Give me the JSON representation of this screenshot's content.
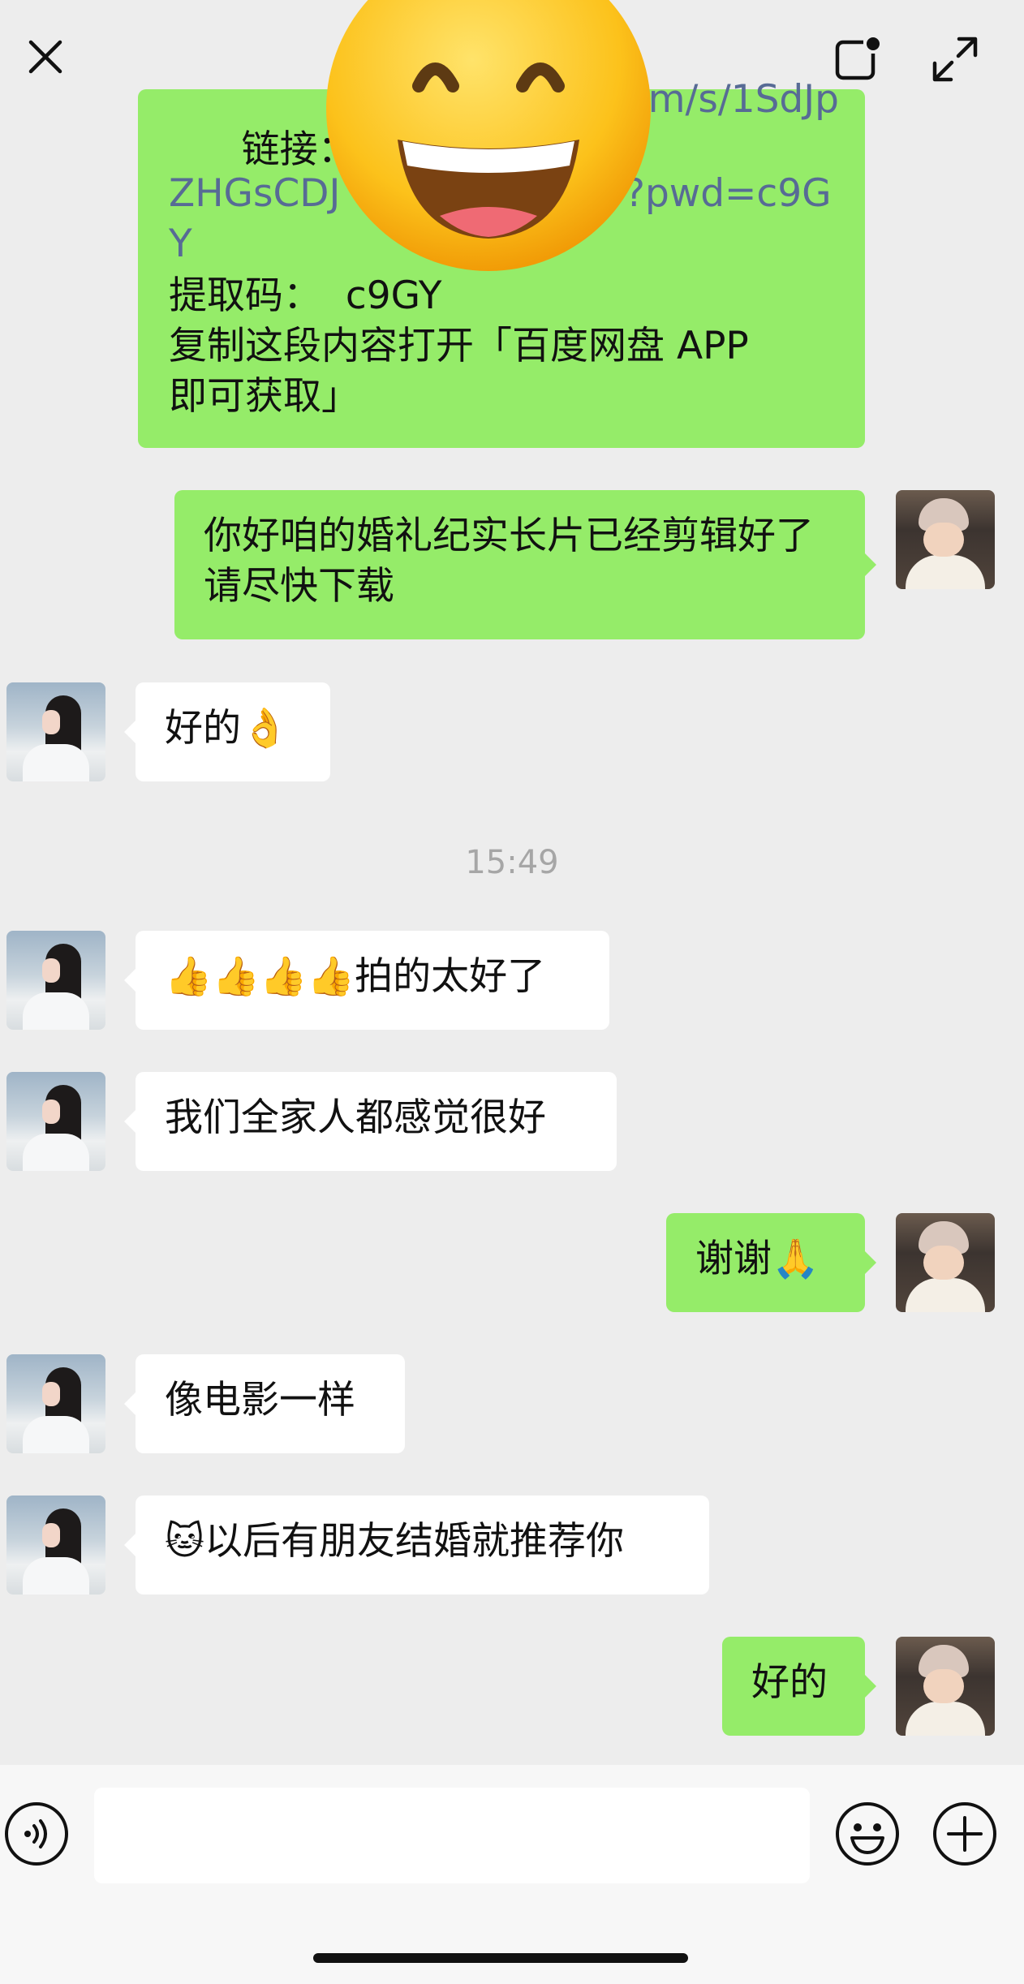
{
  "top_bar": {
    "close_icon": "close-icon",
    "minimize_icon": "floating-window-icon",
    "expand_icon": "expand-icon"
  },
  "sticker": "grinning-face-emoji",
  "messages": [
    {
      "side": "right",
      "text_link_partial_1": "链接：http",
      "text_link_partial_2": "om/s/1SdJp",
      "text_link_partial_3": "ZHGsCDJ",
      "text_link_partial_4": "?pwd=c9G",
      "text_link_partial_5": "Y",
      "code_line": "提取码：  c9GY",
      "instruction_line_1": "复制这段内容打开「百度网盘 APP",
      "instruction_line_2": "即可获取」"
    },
    {
      "side": "right",
      "text": "你好咱的婚礼纪实长片已经剪辑好了请尽快下载"
    },
    {
      "side": "left",
      "text": "好的👌"
    },
    {
      "side": "left",
      "text": "👍👍👍👍拍的太好了"
    },
    {
      "side": "left",
      "text": "我们全家人都感觉很好"
    },
    {
      "side": "right",
      "text": "谢谢🙏"
    },
    {
      "side": "left",
      "text": "像电影一样"
    },
    {
      "side": "left",
      "text": "🐱以后有朋友结婚就推荐你"
    },
    {
      "side": "right",
      "text": "好的"
    }
  ],
  "timestamp": "15:49",
  "input_bar": {
    "voice_icon": "voice-icon",
    "emoji_icon": "emoji-icon",
    "plus_icon": "plus-icon",
    "input_value": ""
  },
  "colors": {
    "my_bubble": "#95ec69",
    "their_bubble": "#ffffff",
    "chat_background": "#ededed",
    "link": "#576b95"
  }
}
